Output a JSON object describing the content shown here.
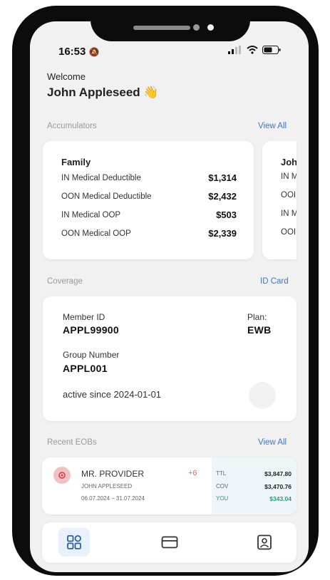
{
  "status_bar": {
    "time": "16:53"
  },
  "header": {
    "welcome": "Welcome",
    "user_name": "John Appleseed",
    "wave_emoji": "👋"
  },
  "accumulators": {
    "title": "Accumulators",
    "view_all": "View All",
    "cards": [
      {
        "title": "Family",
        "rows": [
          {
            "label": "IN Medical Deductible",
            "value": "$1,314"
          },
          {
            "label": "OON Medical Deductible",
            "value": "$2,432"
          },
          {
            "label": "IN Medical OOP",
            "value": "$503"
          },
          {
            "label": "OON Medical OOP",
            "value": "$2,339"
          }
        ]
      },
      {
        "title": "Joh",
        "rows": [
          {
            "label": "IN M"
          },
          {
            "label": "OOI"
          },
          {
            "label": "IN M"
          },
          {
            "label": "OOI"
          }
        ]
      }
    ]
  },
  "coverage": {
    "title": "Coverage",
    "id_card_link": "ID Card",
    "member_id_label": "Member ID",
    "member_id": "APPL99900",
    "plan_label": "Plan:",
    "plan": "EWB",
    "group_number_label": "Group Number",
    "group_number": "APPL001",
    "active_since": "active since 2024-01-01"
  },
  "recent_eobs": {
    "title": "Recent EOBs",
    "view_all": "View All",
    "items": [
      {
        "provider": "MR. PROVIDER",
        "extra_count": "+6",
        "patient": "JOHN APPLESEED",
        "date_range": "06.07.2024 – 31.07.2024",
        "totals": [
          {
            "label": "TTL",
            "value": "$3,847.80"
          },
          {
            "label": "COV",
            "value": "$3,470.76"
          },
          {
            "label": "YOU",
            "value": "$343.04"
          }
        ]
      }
    ]
  },
  "colors": {
    "accent": "#3b76c8",
    "you_amount": "#2aa07a",
    "eob_badge": "#e06a6a",
    "extra_count": "#e26b6b"
  },
  "tab_bar": {
    "icons": [
      "dashboard-icon",
      "card-icon",
      "profile-icon"
    ],
    "active_index": 0
  }
}
